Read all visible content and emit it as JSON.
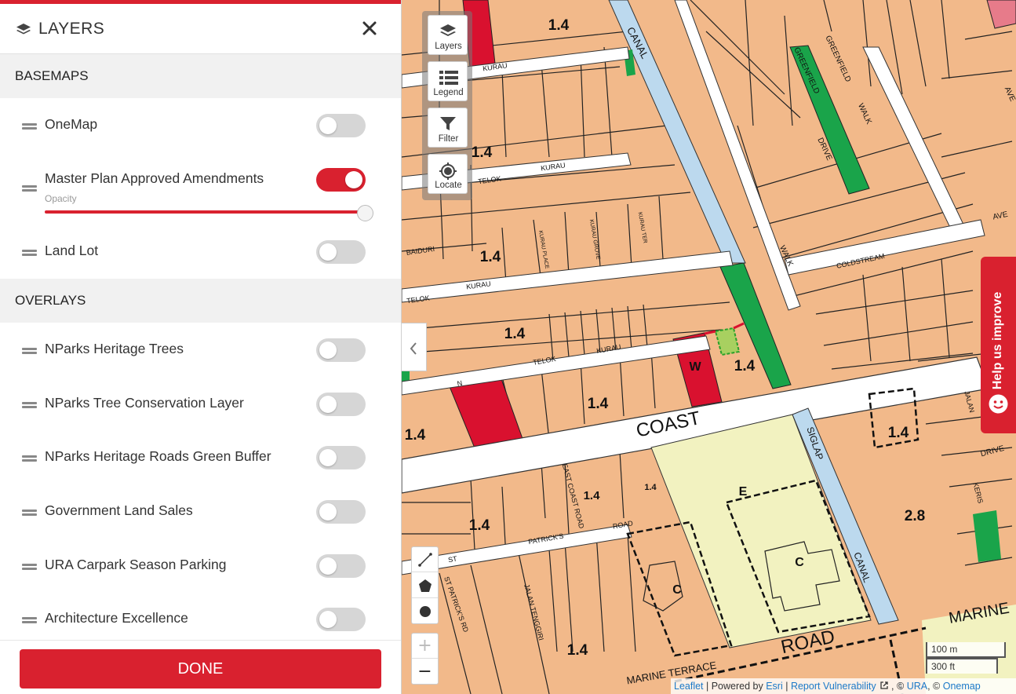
{
  "panel": {
    "title": "LAYERS",
    "sections": {
      "basemaps": "BASEMAPS",
      "overlays": "OVERLAYS"
    },
    "basemaps": [
      {
        "label": "OneMap",
        "on": false
      },
      {
        "label": "Master Plan Approved Amendments",
        "on": true
      },
      {
        "label": "Land Lot",
        "on": false
      }
    ],
    "opacity_label": "Opacity",
    "opacity_value": 1.0,
    "overlays": [
      {
        "label": "NParks Heritage Trees",
        "on": false
      },
      {
        "label": "NParks Tree Conservation Layer",
        "on": false
      },
      {
        "label": "NParks Heritage Roads Green Buffer",
        "on": false
      },
      {
        "label": "Government Land Sales",
        "on": false
      },
      {
        "label": "URA Carpark Season Parking",
        "on": false
      },
      {
        "label": "Architecture Excellence",
        "on": false
      }
    ],
    "done_label": "DONE"
  },
  "map_controls": {
    "layers": "Layers",
    "legend": "Legend",
    "filter": "Filter",
    "locate": "Locate",
    "zoom_in": "+",
    "zoom_out": "−"
  },
  "help_tab": "Help us improve",
  "scale": {
    "metric": "100 m",
    "imperial": "300 ft"
  },
  "attribution": {
    "leaflet": "Leaflet",
    "powered": " | Powered by ",
    "esri": "Esri",
    "sep1": " | ",
    "report": "Report Vulnerability",
    "sep2": " , © ",
    "ura": "URA",
    "sep3": ", © ",
    "onemap": "Onemap"
  },
  "map_labels": {
    "plot_ratios": [
      "1.4",
      "1.4",
      "1.4",
      "1.4",
      "1.4",
      "1.4",
      "1.4",
      "1.4",
      "1.4",
      "1.4",
      "1.4",
      "1.4",
      "2.8"
    ],
    "zones": [
      "W",
      "E",
      "C",
      "C"
    ],
    "roads": [
      "CANAL",
      "KURAU",
      "KURAU",
      "TELOK",
      "BAIDURI",
      "TELOK",
      "KURAU",
      "TELOK",
      "KURAU",
      "N",
      "COAST",
      "SIGLAP",
      "CANAL",
      "ROAD",
      "MARINE",
      "PATRICK'S",
      "ROAD",
      "ST",
      "ST PATRICK'S RD",
      "JALAN TENGGIRI",
      "EAST COAST ROAD",
      "GREENFIELD",
      "GREENFIELD",
      "DRIVE",
      "WALK",
      "WALK",
      "COLDSTREAM",
      "AVE",
      "AVE",
      "DRIVE",
      "KERIS",
      "JALAN",
      "MARINE TERRACE",
      "KURAU PLACE",
      "KURAU GROVE",
      "KURAU TER"
    ]
  }
}
